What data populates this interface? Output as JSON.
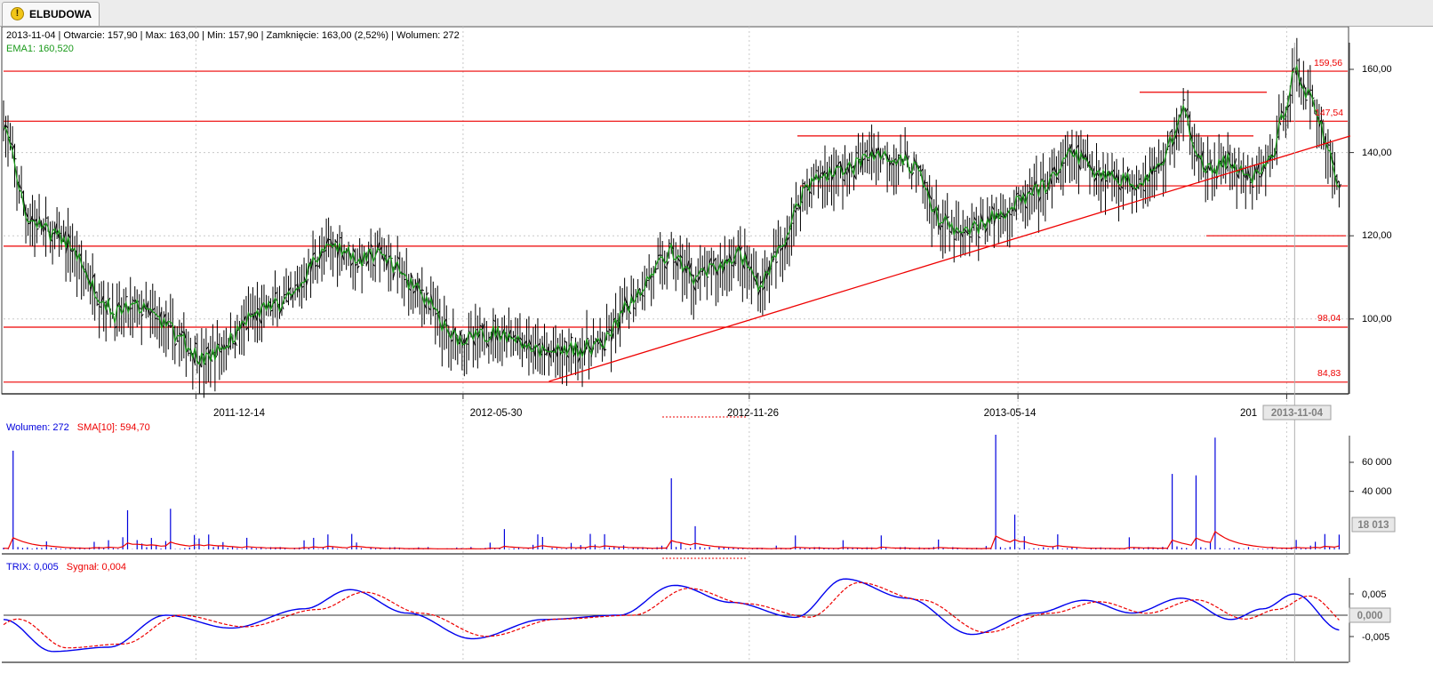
{
  "tab": {
    "label": "ELBUDOWA",
    "icon": "warning-icon"
  },
  "price_panel": {
    "info_line": "2013-11-04 | Otwarcie: 157,90 | Max: 163,00 | Min: 157,90 | Zamknięcie: 163,00 (2,52%)  | Wolumen: 272",
    "ema_label": "EMA1: 160,520",
    "y_ticks": [
      "160,00",
      "140,00",
      "120,00",
      "100,00"
    ],
    "level_labels": [
      "159,56",
      "147,54",
      "98,04",
      "84,83"
    ],
    "x_ticks": [
      "2011-12-14",
      "2012-05-30",
      "2012-11-26",
      "2013-05-14",
      "201"
    ],
    "cursor_date": "2013-11-04"
  },
  "volume_panel": {
    "label_volume": "Wolumen: 272",
    "label_sma": "SMA[10]: 594,70",
    "y_ticks": [
      "60 000",
      "40 000"
    ],
    "cursor_value": "18 013"
  },
  "trix_panel": {
    "label_trix": "TRIX: 0,005",
    "label_signal": "Sygnał: 0,004",
    "y_ticks": [
      "0,005",
      "-0,005"
    ],
    "cursor_value": "0,000"
  },
  "colors": {
    "bars": "#000000",
    "ema": "#1a9a1a",
    "levels": "#ee0000",
    "volume": "#0000dd",
    "sma": "#ee0000",
    "trix": "#0000ee",
    "signal": "#ee0000",
    "grid": "#c8c8c8"
  },
  "chart_data": [
    {
      "type": "line",
      "title": "ELBUDOWA",
      "x_ticks": [
        "2011-12-14",
        "2012-05-30",
        "2012-11-26",
        "2013-05-14"
      ],
      "ylim": [
        82,
        166
      ],
      "grid": true,
      "series": [
        {
          "name": "EMA1",
          "points": [
            [
              "2011-08-15",
              148
            ],
            [
              "2011-08-29",
              125
            ],
            [
              "2011-09-12",
              121
            ],
            [
              "2011-09-26",
              118
            ],
            [
              "2011-10-10",
              108
            ],
            [
              "2011-10-24",
              101
            ],
            [
              "2011-11-07",
              103
            ],
            [
              "2011-11-21",
              100
            ],
            [
              "2011-12-05",
              95
            ],
            [
              "2011-12-19",
              90
            ],
            [
              "2012-01-02",
              94
            ],
            [
              "2012-01-16",
              100
            ],
            [
              "2012-01-30",
              103
            ],
            [
              "2012-02-13",
              105
            ],
            [
              "2012-02-27",
              115
            ],
            [
              "2012-03-12",
              118
            ],
            [
              "2012-03-26",
              114
            ],
            [
              "2012-04-09",
              116
            ],
            [
              "2012-04-23",
              110
            ],
            [
              "2012-05-07",
              105
            ],
            [
              "2012-05-21",
              96
            ],
            [
              "2012-06-04",
              95
            ],
            [
              "2012-06-18",
              97
            ],
            [
              "2012-07-02",
              96
            ],
            [
              "2012-07-16",
              92
            ],
            [
              "2012-07-30",
              92
            ],
            [
              "2012-08-13",
              93
            ],
            [
              "2012-08-27",
              94
            ],
            [
              "2012-09-10",
              103
            ],
            [
              "2012-09-24",
              110
            ],
            [
              "2012-10-08",
              116
            ],
            [
              "2012-10-22",
              110
            ],
            [
              "2012-11-05",
              112
            ],
            [
              "2012-11-19",
              116
            ],
            [
              "2012-12-03",
              108
            ],
            [
              "2012-12-17",
              118
            ],
            [
              "2012-12-31",
              132
            ],
            [
              "2013-01-14",
              135
            ],
            [
              "2013-01-28",
              136
            ],
            [
              "2013-02-11",
              140
            ],
            [
              "2013-02-25",
              139
            ],
            [
              "2013-03-11",
              136
            ],
            [
              "2013-03-25",
              124
            ],
            [
              "2013-04-08",
              120
            ],
            [
              "2013-04-22",
              123
            ],
            [
              "2013-05-06",
              126
            ],
            [
              "2013-05-20",
              129
            ],
            [
              "2013-06-03",
              133
            ],
            [
              "2013-06-17",
              140
            ],
            [
              "2013-07-01",
              136
            ],
            [
              "2013-07-15",
              134
            ],
            [
              "2013-07-29",
              133
            ],
            [
              "2013-08-12",
              137
            ],
            [
              "2013-08-26",
              150
            ],
            [
              "2013-09-09",
              135
            ],
            [
              "2013-09-23",
              138
            ],
            [
              "2013-10-07",
              133
            ],
            [
              "2013-10-21",
              139
            ],
            [
              "2013-11-04",
              160
            ],
            [
              "2013-11-18",
              150
            ],
            [
              "2013-12-02",
              132
            ]
          ]
        }
      ],
      "horizontal_levels": [
        159.56,
        147.54,
        98.04,
        84.83,
        117.5,
        132,
        144,
        154.5,
        120
      ],
      "trend_line": {
        "from": [
          "2012-07-23",
          85
        ],
        "to": [
          "2013-12-09",
          144
        ]
      },
      "last_bar": {
        "date": "2013-11-04",
        "open": 157.9,
        "high": 163.0,
        "low": 157.9,
        "close": 163.0,
        "change_pct": 2.52,
        "volume": 272,
        "ema": 160.52
      }
    },
    {
      "type": "bar",
      "title": "Wolumen",
      "ylim": [
        0,
        80000
      ],
      "last_volume": 272,
      "sma_10": 594.7,
      "spikes": [
        [
          "2011-08-22",
          68000
        ],
        [
          "2011-10-31",
          27000
        ],
        [
          "2011-11-28",
          28000
        ],
        [
          "2012-01-16",
          8000
        ],
        [
          "2012-06-25",
          14000
        ],
        [
          "2012-10-08",
          49000
        ],
        [
          "2012-10-22",
          16000
        ],
        [
          "2013-04-29",
          79000
        ],
        [
          "2013-05-13",
          24000
        ],
        [
          "2013-08-19",
          52000
        ],
        [
          "2013-09-02",
          51000
        ],
        [
          "2013-09-16",
          77000
        ]
      ]
    },
    {
      "type": "line",
      "title": "TRIX",
      "ylim": [
        -0.009,
        0.009
      ],
      "last_trix": 0.005,
      "last_signal": 0.004
    }
  ]
}
